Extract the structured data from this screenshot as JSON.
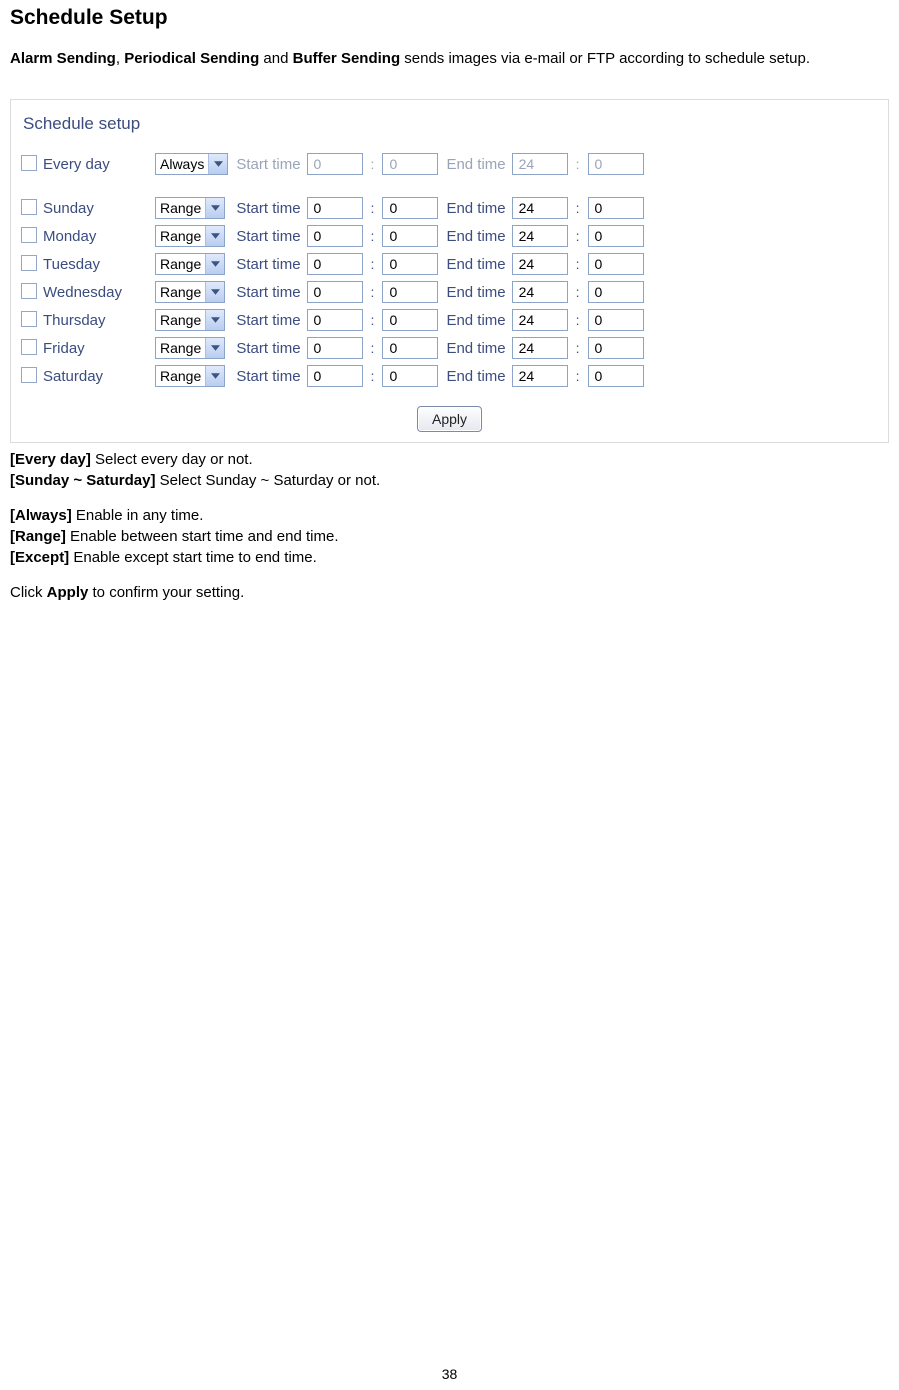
{
  "title": "Schedule Setup",
  "intro": {
    "b1": "Alarm Sending",
    "sep1": ", ",
    "b2": "Periodical Sending",
    "mid": " and ",
    "b3": "Buffer Sending",
    "tail": " sends images via e-mail or FTP according to schedule setup."
  },
  "panel_title": "Schedule setup",
  "rows": [
    {
      "day": "Every day",
      "mode": "Always",
      "sh": "0",
      "sm": "0",
      "eh": "24",
      "em": "0",
      "disabled": true
    },
    {
      "day": "Sunday",
      "mode": "Range",
      "sh": "0",
      "sm": "0",
      "eh": "24",
      "em": "0",
      "disabled": false
    },
    {
      "day": "Monday",
      "mode": "Range",
      "sh": "0",
      "sm": "0",
      "eh": "24",
      "em": "0",
      "disabled": false
    },
    {
      "day": "Tuesday",
      "mode": "Range",
      "sh": "0",
      "sm": "0",
      "eh": "24",
      "em": "0",
      "disabled": false
    },
    {
      "day": "Wednesday",
      "mode": "Range",
      "sh": "0",
      "sm": "0",
      "eh": "24",
      "em": "0",
      "disabled": false
    },
    {
      "day": "Thursday",
      "mode": "Range",
      "sh": "0",
      "sm": "0",
      "eh": "24",
      "em": "0",
      "disabled": false
    },
    {
      "day": "Friday",
      "mode": "Range",
      "sh": "0",
      "sm": "0",
      "eh": "24",
      "em": "0",
      "disabled": false
    },
    {
      "day": "Saturday",
      "mode": "Range",
      "sh": "0",
      "sm": "0",
      "eh": "24",
      "em": "0",
      "disabled": false
    }
  ],
  "labels": {
    "start": "Start time",
    "end": "End time",
    "colon": ":",
    "apply": "Apply"
  },
  "desc": {
    "d1b": "[Every day]",
    "d1t": " Select every day or not.",
    "d2b": "[Sunday ~ Saturday]",
    "d2t": " Select Sunday ~ Saturday or not.",
    "d3b": "[Always]",
    "d3t": " Enable in any time.",
    "d4b": "[Range]",
    "d4t": " Enable between start time and end time.",
    "d5b": "[Except]",
    "d5t": " Enable except start time to end time.",
    "d6a": "Click ",
    "d6b": "Apply",
    "d6c": " to confirm your setting."
  },
  "page_number": "38"
}
